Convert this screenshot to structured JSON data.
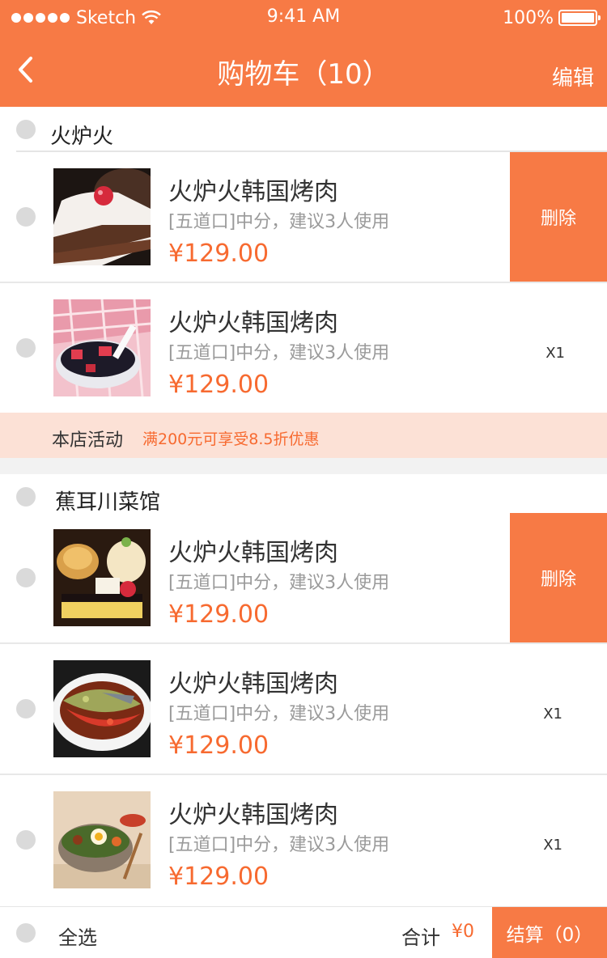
{
  "status_bar": {
    "carrier": "Sketch",
    "time": "9:41 AM",
    "battery": "100%"
  },
  "nav": {
    "title": "购物车（10）",
    "edit_label": "编辑"
  },
  "colors": {
    "accent": "#F77A45",
    "price": "#F76A30",
    "promo_bg": "#FCE1D6"
  },
  "shops": [
    {
      "name": "火炉火",
      "items": [
        {
          "title": "火炉火韩国烤肉",
          "desc": "[五道口]中分，建议3人使用",
          "price": "¥129.00",
          "action": "删除",
          "image": "strawberry-cake"
        },
        {
          "title": "火炉火韩国烤肉",
          "desc": "[五道口]中分，建议3人使用",
          "price": "¥129.00",
          "qty": "X1",
          "image": "grass-jelly-dessert"
        }
      ],
      "promo": {
        "label": "本店活动",
        "text": "满200元可享受8.5折优惠"
      }
    },
    {
      "name": "蕉耳川菜馆",
      "items": [
        {
          "title": "火炉火韩国烤肉",
          "desc": "[五道口]中分，建议3人使用",
          "price": "¥129.00",
          "action": "删除",
          "image": "pastry-platter"
        },
        {
          "title": "火炉火韩国烤肉",
          "desc": "[五道口]中分，建议3人使用",
          "price": "¥129.00",
          "qty": "X1",
          "image": "steamed-fish-chili"
        },
        {
          "title": "火炉火韩国烤肉",
          "desc": "[五道口]中分，建议3人使用",
          "price": "¥129.00",
          "qty": "X1",
          "image": "bibimbap-bowl"
        }
      ]
    }
  ],
  "footer": {
    "select_all": "全选",
    "total_label": "合计",
    "total_value": "¥0",
    "checkout_label": "结算（0）"
  }
}
